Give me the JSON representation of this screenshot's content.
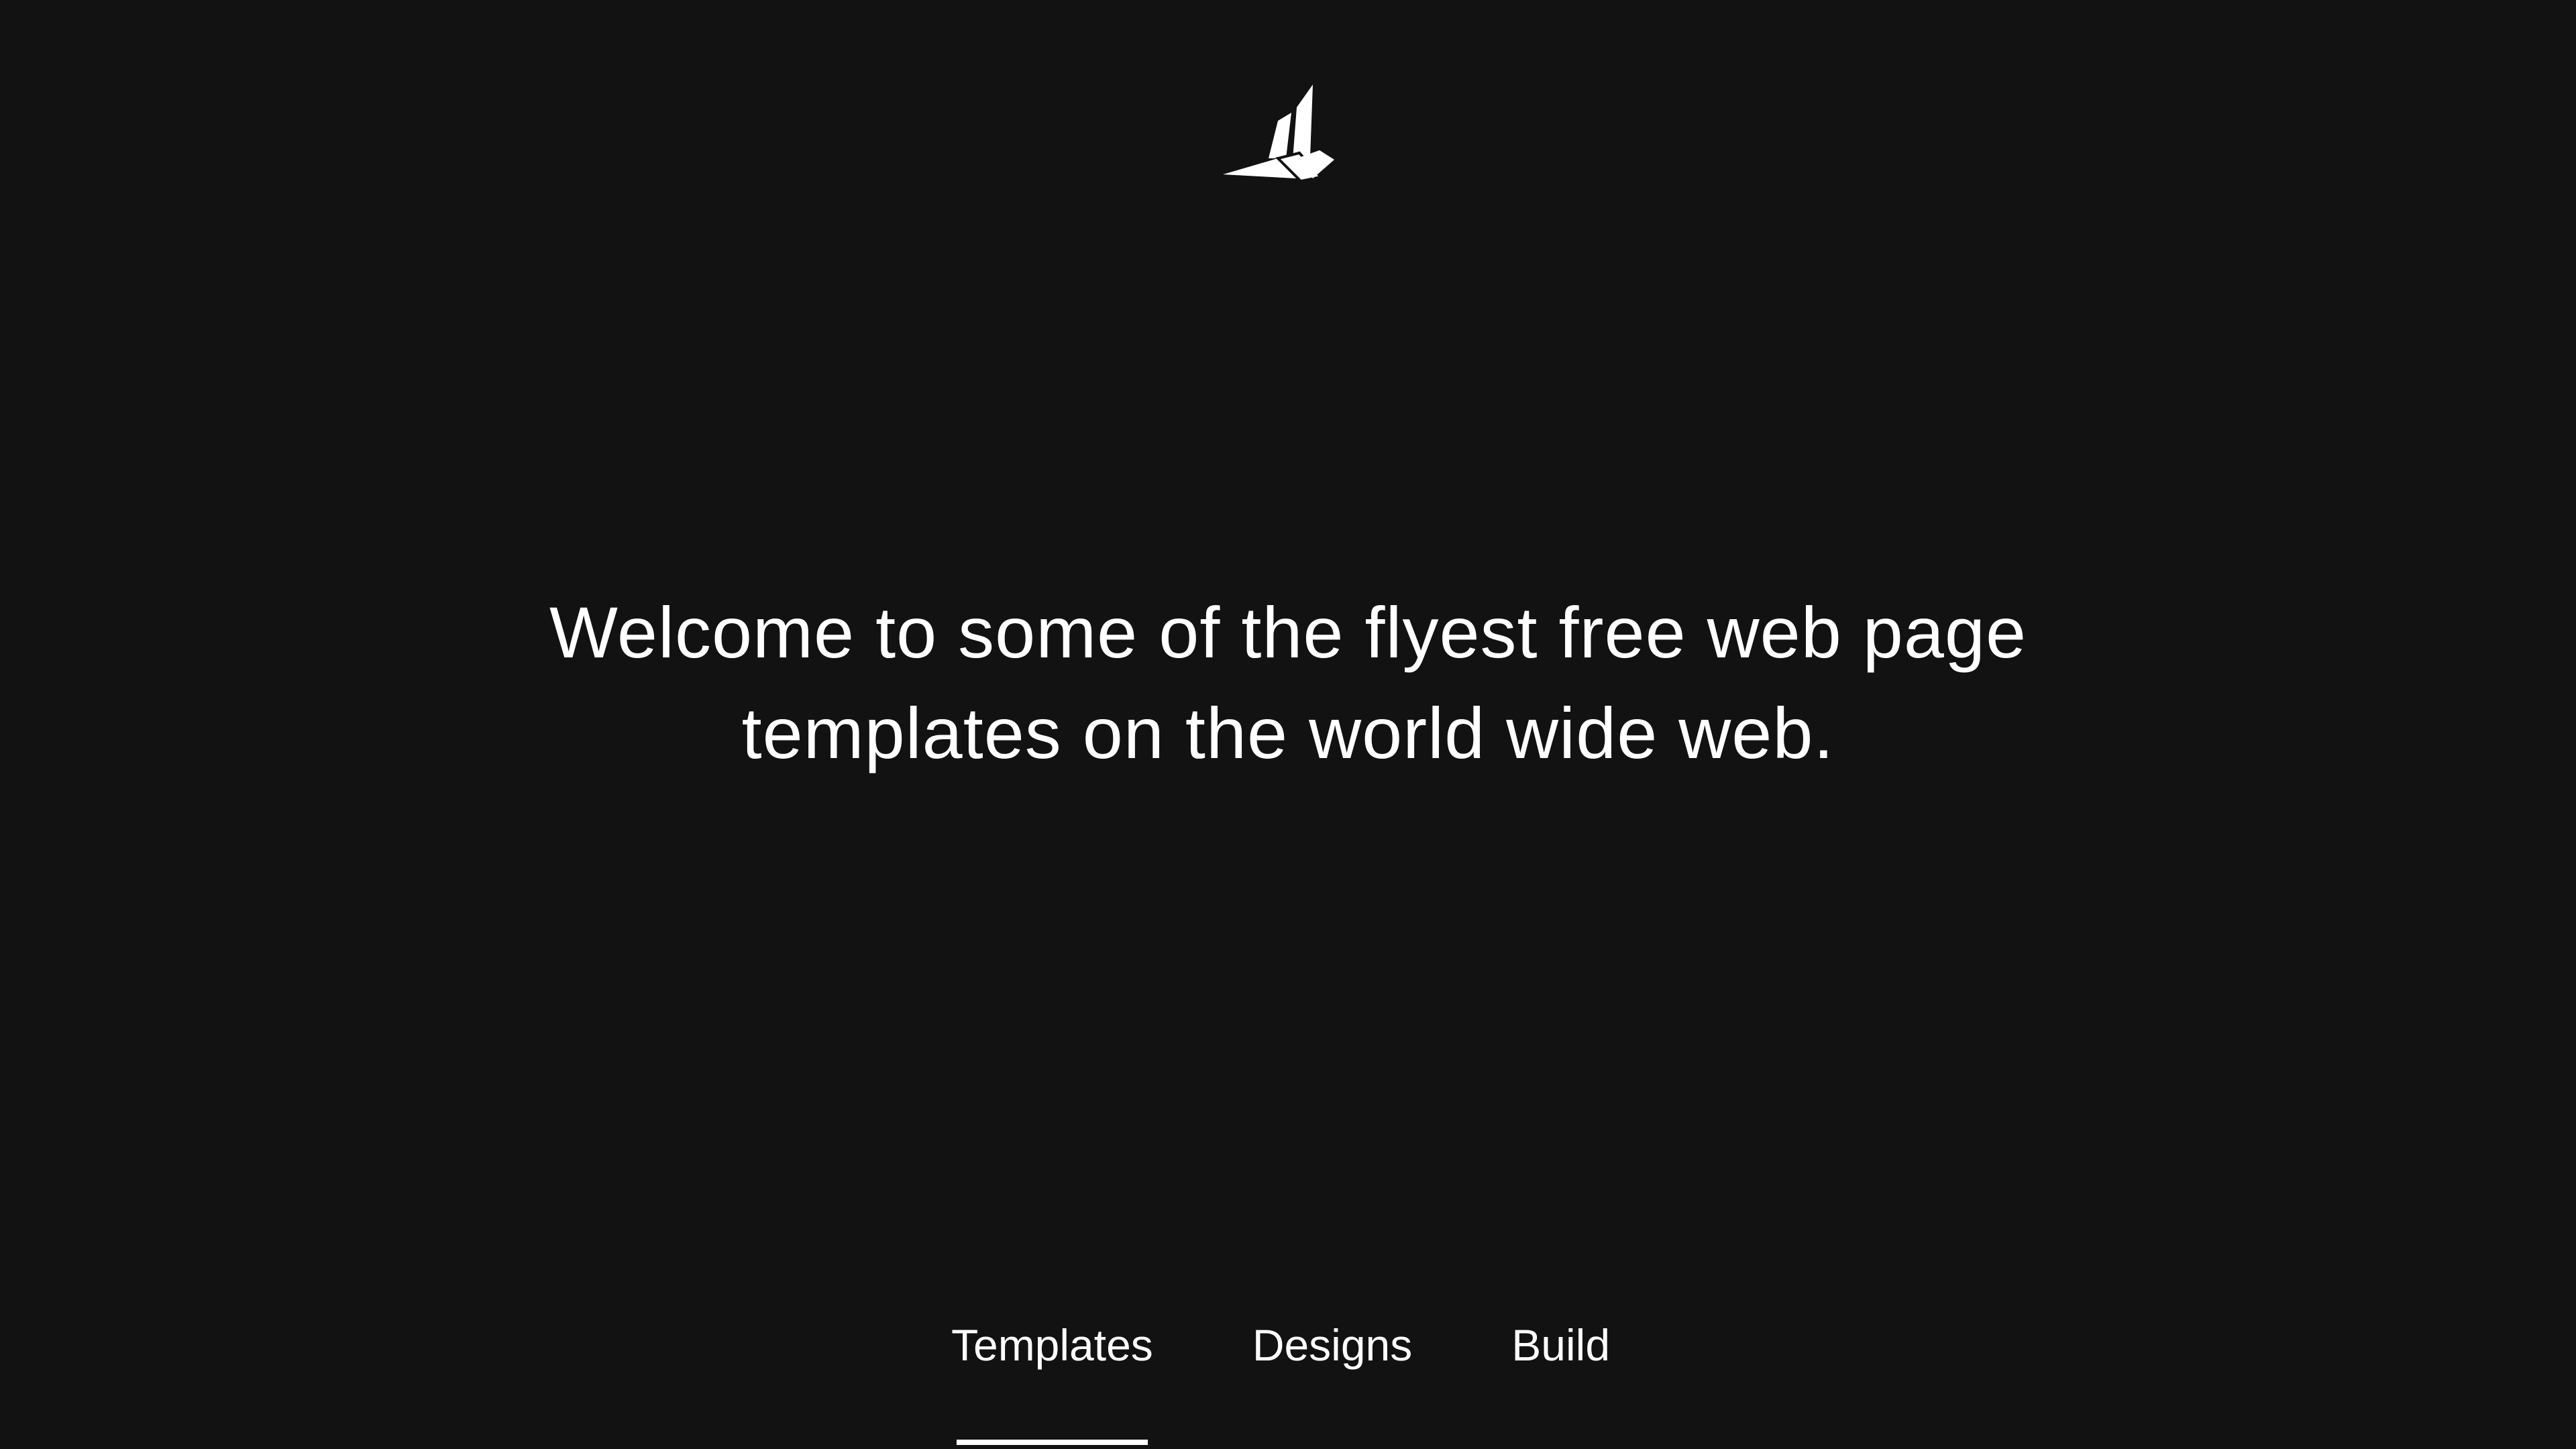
{
  "logo": {
    "icon": "bird-logo-icon",
    "color": "#ffffff"
  },
  "hero": {
    "line1": "Welcome to some of the flyest free web page",
    "line2": "templates on the world wide web."
  },
  "nav": {
    "tabs": [
      {
        "label": "Templates",
        "active": true
      },
      {
        "label": "Designs",
        "active": false
      },
      {
        "label": "Build",
        "active": false
      }
    ]
  },
  "colors": {
    "background": "#121212",
    "text": "#ffffff"
  }
}
